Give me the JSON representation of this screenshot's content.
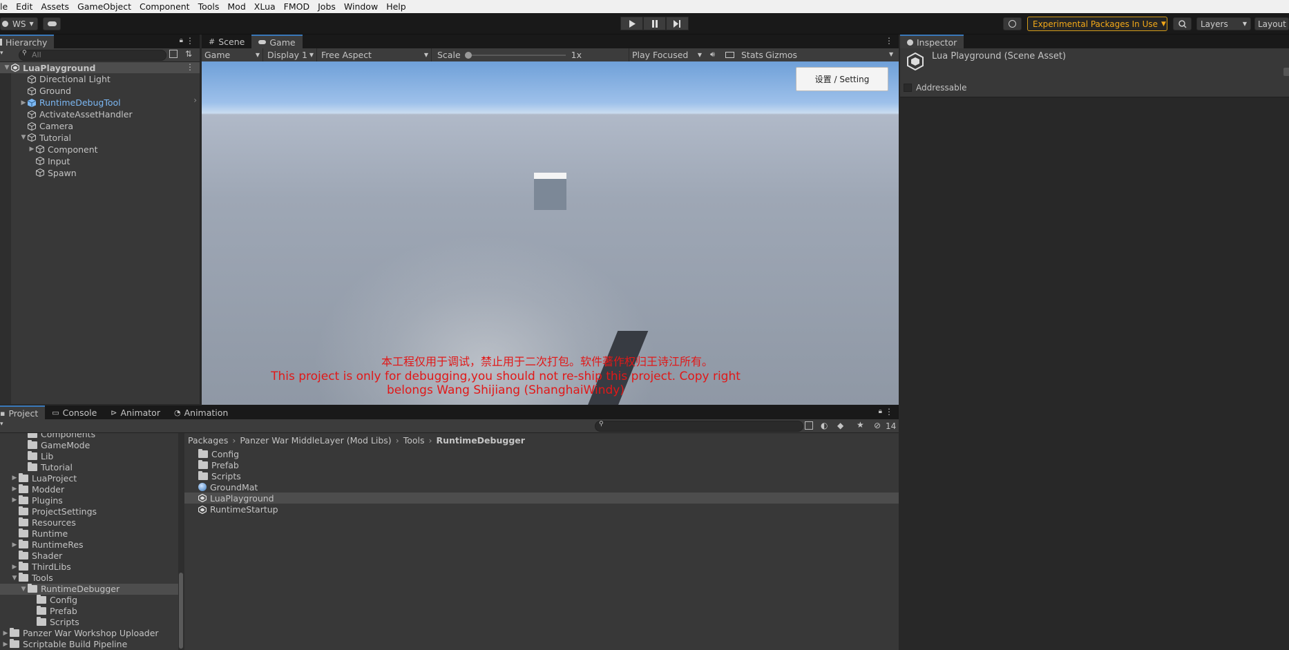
{
  "menu": [
    "le",
    "Edit",
    "Assets",
    "GameObject",
    "Component",
    "Tools",
    "Mod",
    "XLua",
    "FMOD",
    "Jobs",
    "Window",
    "Help"
  ],
  "toolbar": {
    "account": "WS",
    "experimental": "Experimental Packages In Use",
    "layers": "Layers",
    "layout": "Layout"
  },
  "hierarchy": {
    "tab": "Hierarchy",
    "search_placeholder": "All",
    "items": [
      {
        "label": "LuaPlayground",
        "depth": 0,
        "arrow": "▼",
        "kind": "scene",
        "selected": true
      },
      {
        "label": "Directional Light",
        "depth": 2,
        "arrow": "",
        "kind": "cube"
      },
      {
        "label": "Ground",
        "depth": 2,
        "arrow": "",
        "kind": "cube"
      },
      {
        "label": "RuntimeDebugTool",
        "depth": 2,
        "arrow": "▶",
        "kind": "prefab"
      },
      {
        "label": "ActivateAssetHandler",
        "depth": 2,
        "arrow": "",
        "kind": "cube"
      },
      {
        "label": "Camera",
        "depth": 2,
        "arrow": "",
        "kind": "cube"
      },
      {
        "label": "Tutorial",
        "depth": 2,
        "arrow": "▼",
        "kind": "cube"
      },
      {
        "label": "Component",
        "depth": 3,
        "arrow": "▶",
        "kind": "cube"
      },
      {
        "label": "Input",
        "depth": 3,
        "arrow": "",
        "kind": "cube"
      },
      {
        "label": "Spawn",
        "depth": 3,
        "arrow": "",
        "kind": "cube"
      }
    ]
  },
  "game": {
    "tabs": [
      "Scene",
      "Game"
    ],
    "toolbar": {
      "mode": "Game",
      "display": "Display 1",
      "aspect": "Free Aspect",
      "scale_label": "Scale",
      "scale_value": "1x",
      "play_focused": "Play Focused",
      "stats": "Stats",
      "gizmos": "Gizmos"
    },
    "setting_button": "设置 / Setting",
    "notice_cn": "本工程仅用于调试，禁止用于二次打包。软件著作权归王诗江所有。",
    "notice_en": "This project is only for debugging,you should not re-ship this project. Copy right belongs Wang Shijiang (ShanghaiWindy)"
  },
  "inspector": {
    "tab": "Inspector",
    "title": "Lua Playground (Scene Asset)",
    "addressable": "Addressable"
  },
  "project": {
    "tabs": [
      "Project",
      "Console",
      "Animator",
      "Animation"
    ],
    "hidden_count": "14",
    "tree": [
      {
        "label": "Components",
        "depth": 2,
        "arrow": ""
      },
      {
        "label": "GameMode",
        "depth": 2,
        "arrow": ""
      },
      {
        "label": "Lib",
        "depth": 2,
        "arrow": ""
      },
      {
        "label": "Tutorial",
        "depth": 2,
        "arrow": ""
      },
      {
        "label": "LuaProject",
        "depth": 1,
        "arrow": "▶"
      },
      {
        "label": "Modder",
        "depth": 1,
        "arrow": "▶"
      },
      {
        "label": "Plugins",
        "depth": 1,
        "arrow": "▶"
      },
      {
        "label": "ProjectSettings",
        "depth": 1,
        "arrow": ""
      },
      {
        "label": "Resources",
        "depth": 1,
        "arrow": ""
      },
      {
        "label": "Runtime",
        "depth": 1,
        "arrow": ""
      },
      {
        "label": "RuntimeRes",
        "depth": 1,
        "arrow": "▶"
      },
      {
        "label": "Shader",
        "depth": 1,
        "arrow": ""
      },
      {
        "label": "ThirdLibs",
        "depth": 1,
        "arrow": "▶"
      },
      {
        "label": "Tools",
        "depth": 1,
        "arrow": "▼"
      },
      {
        "label": "RuntimeDebugger",
        "depth": 2,
        "arrow": "▼",
        "selected": true
      },
      {
        "label": "Config",
        "depth": 3,
        "arrow": ""
      },
      {
        "label": "Prefab",
        "depth": 3,
        "arrow": ""
      },
      {
        "label": "Scripts",
        "depth": 3,
        "arrow": ""
      },
      {
        "label": "Panzer War Workshop Uploader",
        "depth": 0,
        "arrow": "▶"
      },
      {
        "label": "Scriptable Build Pipeline",
        "depth": 0,
        "arrow": "▶"
      }
    ],
    "breadcrumb": [
      "Packages",
      "Panzer War MiddleLayer (Mod Libs)",
      "Tools",
      "RuntimeDebugger"
    ],
    "files": [
      {
        "label": "Config",
        "kind": "folder"
      },
      {
        "label": "Prefab",
        "kind": "folder"
      },
      {
        "label": "Scripts",
        "kind": "folder"
      },
      {
        "label": "GroundMat",
        "kind": "material"
      },
      {
        "label": "LuaPlayground",
        "kind": "scene",
        "selected": true
      },
      {
        "label": "RuntimeStartup",
        "kind": "scene"
      }
    ]
  },
  "colors": {
    "accent": "#3a79bb",
    "warning": "#f2a818",
    "notice": "#e11818",
    "prefab": "#7cb8f4"
  }
}
